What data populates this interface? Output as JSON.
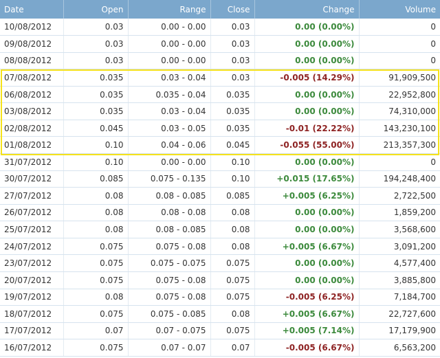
{
  "headers": {
    "date": "Date",
    "open": "Open",
    "range": "Range",
    "close": "Close",
    "change": "Change",
    "volume": "Volume"
  },
  "colors": {
    "header_bg": "#7ba7cc",
    "positive": "#3c8a3c",
    "negative": "#8e2323",
    "highlight": "#f5e21a"
  },
  "rows": [
    {
      "date": "10/08/2012",
      "open": "0.03",
      "range": "0.00 - 0.00",
      "close": "0.03",
      "change": "0.00 (0.00%)",
      "volume": "0",
      "dir": "pos"
    },
    {
      "date": "09/08/2012",
      "open": "0.03",
      "range": "0.00 - 0.00",
      "close": "0.03",
      "change": "0.00 (0.00%)",
      "volume": "0",
      "dir": "pos"
    },
    {
      "date": "08/08/2012",
      "open": "0.03",
      "range": "0.00 - 0.00",
      "close": "0.03",
      "change": "0.00 (0.00%)",
      "volume": "0",
      "dir": "pos"
    },
    {
      "date": "07/08/2012",
      "open": "0.035",
      "range": "0.03 - 0.04",
      "close": "0.03",
      "change": "-0.005 (14.29%)",
      "volume": "91,909,500",
      "dir": "neg"
    },
    {
      "date": "06/08/2012",
      "open": "0.035",
      "range": "0.035 - 0.04",
      "close": "0.035",
      "change": "0.00 (0.00%)",
      "volume": "22,952,800",
      "dir": "pos"
    },
    {
      "date": "03/08/2012",
      "open": "0.035",
      "range": "0.03 - 0.04",
      "close": "0.035",
      "change": "0.00 (0.00%)",
      "volume": "74,310,000",
      "dir": "pos"
    },
    {
      "date": "02/08/2012",
      "open": "0.045",
      "range": "0.03 - 0.05",
      "close": "0.035",
      "change": "-0.01 (22.22%)",
      "volume": "143,230,100",
      "dir": "neg"
    },
    {
      "date": "01/08/2012",
      "open": "0.10",
      "range": "0.04 - 0.06",
      "close": "0.045",
      "change": "-0.055 (55.00%)",
      "volume": "213,357,300",
      "dir": "neg"
    },
    {
      "date": "31/07/2012",
      "open": "0.10",
      "range": "0.00 - 0.00",
      "close": "0.10",
      "change": "0.00 (0.00%)",
      "volume": "0",
      "dir": "pos"
    },
    {
      "date": "30/07/2012",
      "open": "0.085",
      "range": "0.075 - 0.135",
      "close": "0.10",
      "change": "+0.015 (17.65%)",
      "volume": "194,248,400",
      "dir": "pos"
    },
    {
      "date": "27/07/2012",
      "open": "0.08",
      "range": "0.08 - 0.085",
      "close": "0.085",
      "change": "+0.005 (6.25%)",
      "volume": "2,722,500",
      "dir": "pos"
    },
    {
      "date": "26/07/2012",
      "open": "0.08",
      "range": "0.08 - 0.08",
      "close": "0.08",
      "change": "0.00 (0.00%)",
      "volume": "1,859,200",
      "dir": "pos"
    },
    {
      "date": "25/07/2012",
      "open": "0.08",
      "range": "0.08 - 0.085",
      "close": "0.08",
      "change": "0.00 (0.00%)",
      "volume": "3,568,600",
      "dir": "pos"
    },
    {
      "date": "24/07/2012",
      "open": "0.075",
      "range": "0.075 - 0.08",
      "close": "0.08",
      "change": "+0.005 (6.67%)",
      "volume": "3,091,200",
      "dir": "pos"
    },
    {
      "date": "23/07/2012",
      "open": "0.075",
      "range": "0.075 - 0.075",
      "close": "0.075",
      "change": "0.00 (0.00%)",
      "volume": "4,577,400",
      "dir": "pos"
    },
    {
      "date": "20/07/2012",
      "open": "0.075",
      "range": "0.075 - 0.08",
      "close": "0.075",
      "change": "0.00 (0.00%)",
      "volume": "3,885,800",
      "dir": "pos"
    },
    {
      "date": "19/07/2012",
      "open": "0.08",
      "range": "0.075 - 0.08",
      "close": "0.075",
      "change": "-0.005 (6.25%)",
      "volume": "7,184,700",
      "dir": "neg"
    },
    {
      "date": "18/07/2012",
      "open": "0.075",
      "range": "0.075 - 0.085",
      "close": "0.08",
      "change": "+0.005 (6.67%)",
      "volume": "22,727,600",
      "dir": "pos"
    },
    {
      "date": "17/07/2012",
      "open": "0.07",
      "range": "0.07 - 0.075",
      "close": "0.075",
      "change": "+0.005 (7.14%)",
      "volume": "17,179,900",
      "dir": "pos"
    },
    {
      "date": "16/07/2012",
      "open": "0.075",
      "range": "0.07 - 0.07",
      "close": "0.07",
      "change": "-0.005 (6.67%)",
      "volume": "6,563,200",
      "dir": "neg"
    }
  ]
}
